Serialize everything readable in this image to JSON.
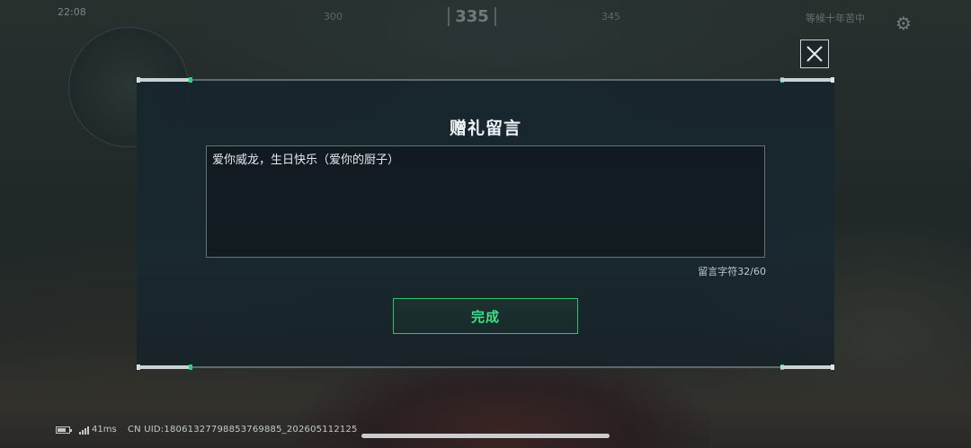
{
  "hud": {
    "time_label": "22:08",
    "heading": "335",
    "compass_left": "300",
    "compass_right": "345",
    "ping_text": "等候十年苦中"
  },
  "dialog": {
    "title": "赠礼留言",
    "message": "爱你威龙，生日快乐（爱你的厨子）",
    "char_count": "留言字符32/60",
    "confirm_label": "完成"
  },
  "status": {
    "latency": "41ms",
    "uid": "CN UID:18061327798853769885_202605112125"
  },
  "colors": {
    "accent_green": "#2bc472",
    "panel_bg": "#16242c"
  },
  "icons": {
    "close": "close-icon",
    "settings": "gear-icon",
    "battery": "battery-icon",
    "signal": "signal-icon"
  }
}
